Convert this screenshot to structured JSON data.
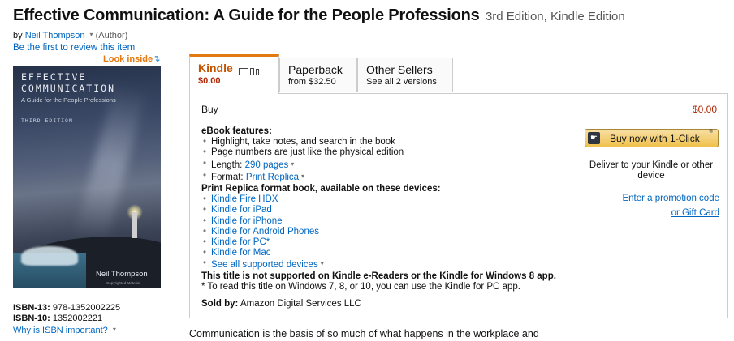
{
  "product": {
    "title": "Effective Communication: A Guide for the People Professions",
    "edition": "3rd Edition, Kindle Edition",
    "by_label": "by",
    "author": "Neil Thompson",
    "author_role": "(Author)",
    "review_link": "Be the first to review this item",
    "look_inside": "Look inside",
    "look_inside_arrow": "↴"
  },
  "cover": {
    "title_line1": "EFFECTIVE",
    "title_line2": "COMMUNICATION",
    "subtitle": "A Guide for the People Professions",
    "edition": "THIRD EDITION",
    "author": "Neil Thompson",
    "copyright": "Copyrighted Material"
  },
  "isbn": {
    "isbn13_label": "ISBN-13:",
    "isbn13_value": "978-1352002225",
    "isbn10_label": "ISBN-10:",
    "isbn10_value": "1352002221",
    "why_link": "Why is ISBN important?"
  },
  "tabs": [
    {
      "name": "Kindle",
      "sub": "$0.00",
      "icons": "kindle-device-icons"
    },
    {
      "name": "Paperback",
      "sub": "from $32.50"
    },
    {
      "name": "Other Sellers",
      "sub": "See all 2 versions"
    }
  ],
  "buybox": {
    "buy_label": "Buy",
    "price": "$0.00",
    "ebook_header": "eBook features:",
    "features": [
      "Highlight, take notes, and search in the book",
      "Page numbers are just like the physical edition"
    ],
    "length_label": "Length:",
    "length_value": "290 pages",
    "format_label": "Format:",
    "format_value": "Print Replica",
    "devices_header": "Print Replica format book, available on these devices:",
    "devices": [
      "Kindle Fire HDX",
      "Kindle for iPad",
      "Kindle for iPhone",
      "Kindle for Android Phones",
      "Kindle for PC*",
      "Kindle for Mac"
    ],
    "see_all_devices": "See all supported devices",
    "warning": "This title is not supported on Kindle e-Readers or the Kindle for Windows 8 app.",
    "note": "* To read this title on Windows 7, 8, or 10, you can use the Kindle for PC app.",
    "sold_by_label": "Sold by:",
    "sold_by_value": "Amazon Digital Services LLC",
    "buy_button": "Buy now with 1-Click",
    "buy_button_mark": "®",
    "deliver_text": "Deliver to your Kindle or other device",
    "promo_link": "Enter a promotion code",
    "gift_link": "or Gift Card"
  },
  "description": {
    "text": "Communication is the basis of so much of what happens in the workplace and"
  },
  "colors": {
    "link": "#0066c0",
    "price": "#b12704",
    "tab_accent": "#e47911",
    "button": "#f0c14b"
  }
}
